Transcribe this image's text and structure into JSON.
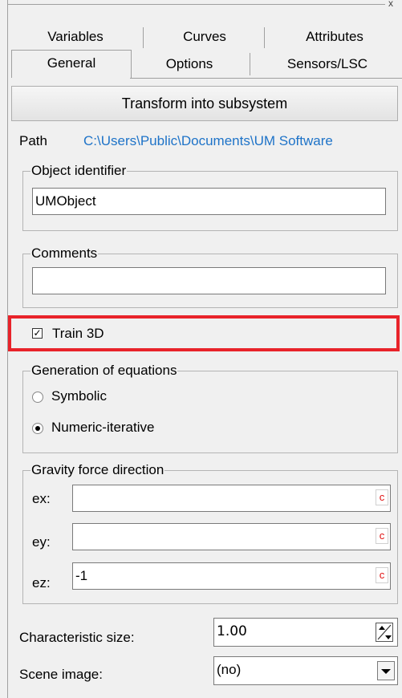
{
  "window": {
    "close_glyph": "x"
  },
  "tabs_row1": [
    {
      "label": "Variables"
    },
    {
      "label": "Curves"
    },
    {
      "label": "Attributes"
    }
  ],
  "tabs_row2": [
    {
      "label": "General",
      "active": true
    },
    {
      "label": "Options"
    },
    {
      "label": "Sensors/LSC"
    }
  ],
  "transform_button": {
    "label": "Transform into subsystem"
  },
  "path": {
    "label": "Path",
    "value": "C:\\Users\\Public\\Documents\\UM Software"
  },
  "object_identifier": {
    "legend": "Object identifier",
    "value": "UMObject"
  },
  "comments": {
    "legend": "Comments",
    "value": ""
  },
  "train3d": {
    "label": "Train 3D",
    "checked": true,
    "check_glyph": "✓"
  },
  "equations": {
    "legend": "Generation of equations",
    "options": [
      {
        "label": "Symbolic",
        "selected": false
      },
      {
        "label": "Numeric-iterative",
        "selected": true
      }
    ]
  },
  "gravity": {
    "legend": "Gravity force direction",
    "fields": [
      {
        "label": "ex:",
        "value": "",
        "button": "c"
      },
      {
        "label": "ey:",
        "value": "",
        "button": "c"
      },
      {
        "label": "ez:",
        "value": "-1",
        "button": "c"
      }
    ]
  },
  "characteristic_size": {
    "label": "Characteristic size:",
    "value": "1.00"
  },
  "scene_image": {
    "label": "Scene image:",
    "value": "(no)"
  },
  "colors": {
    "highlight": "#e8232a",
    "path_link": "#1e73c8",
    "c_button": "#e01010"
  }
}
